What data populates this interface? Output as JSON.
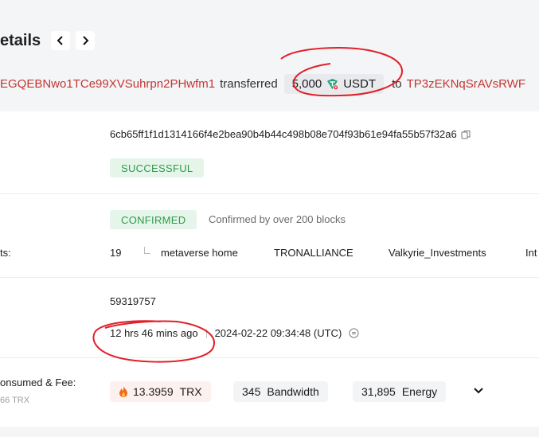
{
  "header": {
    "title": "etails"
  },
  "summary": {
    "from_address": "EGQEBNwo1TCe99XVSuhrpn2PHwfm1",
    "transferred_label": "transferred",
    "amount": "5,000",
    "token": "USDT",
    "to_label": "to",
    "to_address": "TP3zEKNqSrAVsRWF"
  },
  "hash_row": {
    "hash": "6cb65ff1f1d1314166f4e2bea90b4b44c498b08e704f93b61e94fa55b57f32a6",
    "result_badge": "SUCCESSFUL"
  },
  "status_row": {
    "badge": "CONFIRMED",
    "note_prefix": "Confirmed by over",
    "note_count": "200",
    "note_suffix": "blocks",
    "sr_label": "ts:",
    "sr_count": "19",
    "sr_items": [
      "metaverse home",
      "TRONALLIANCE",
      "Valkyrie_Investments",
      "Int"
    ]
  },
  "block_row": {
    "block_number": "59319757",
    "age": "12 hrs 46 mins ago",
    "timestamp": "2024-02-22 09:34:48 (UTC)"
  },
  "fee_row": {
    "label": "onsumed & Fee:",
    "sub_label": "66 TRX",
    "trx_value": "13.3959",
    "trx_unit": "TRX",
    "bandwidth_value": "345",
    "bandwidth_unit": "Bandwidth",
    "energy_value": "31,895",
    "energy_unit": "Energy"
  },
  "colors": {
    "address": "#c23631",
    "success": "#2e9a4a",
    "annotation": "#e0202a"
  }
}
